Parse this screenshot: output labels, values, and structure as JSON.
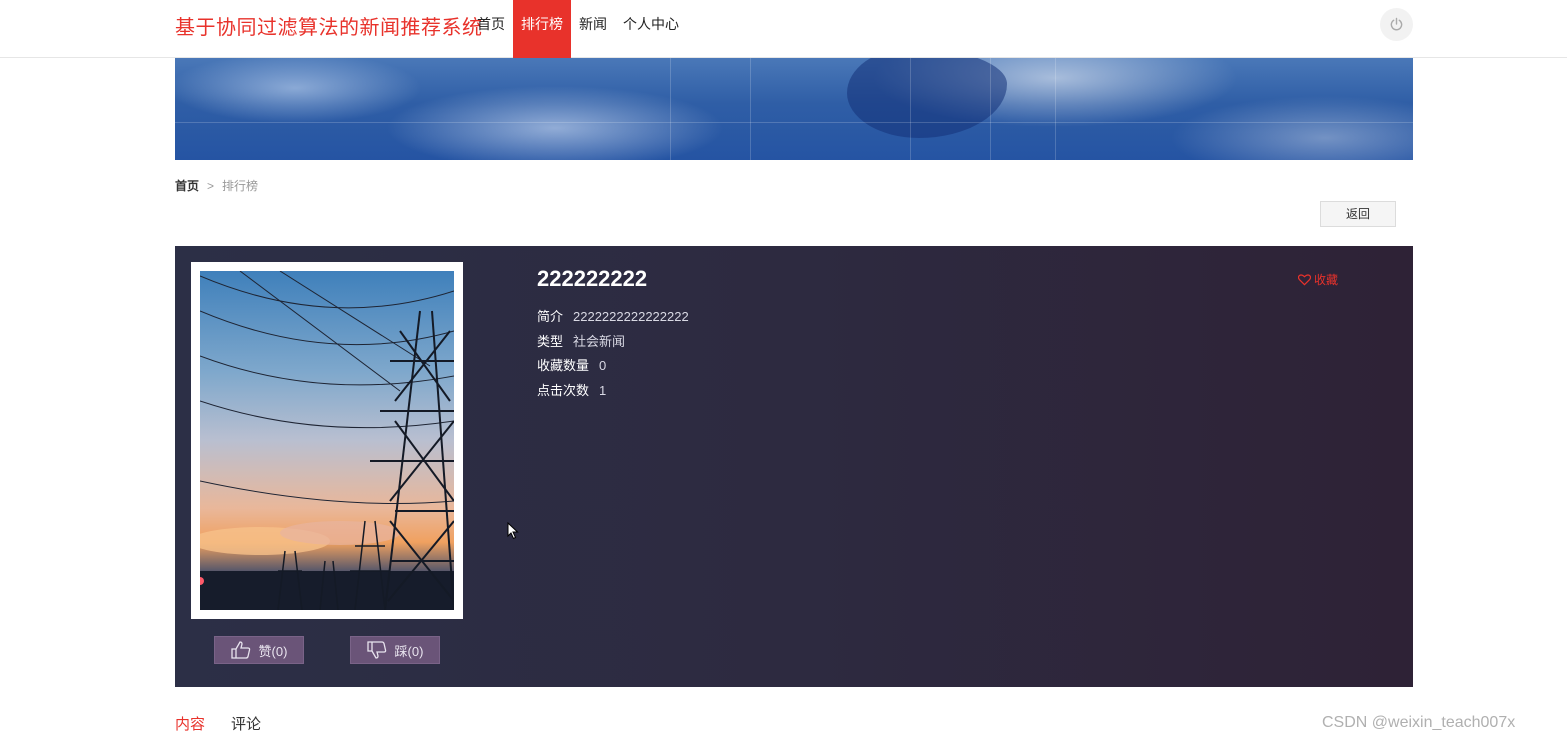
{
  "header": {
    "site_title": "基于协同过滤算法的新闻推荐系统",
    "nav": [
      {
        "label": "首页",
        "active": false
      },
      {
        "label": "排行榜",
        "active": true
      },
      {
        "label": "新闻",
        "active": false
      },
      {
        "label": "个人中心",
        "active": false
      }
    ],
    "power_icon": "power-icon"
  },
  "breadcrumb": {
    "home": "首页",
    "separator": ">",
    "current": "排行榜"
  },
  "actions": {
    "back_label": "返回"
  },
  "detail": {
    "title": "222222222",
    "favorite_label": "收藏",
    "fields": [
      {
        "key": "简介",
        "value": "2222222222222222"
      },
      {
        "key": "类型",
        "value": "社会新闻"
      },
      {
        "key": "收藏数量",
        "value": "0"
      },
      {
        "key": "点击次数",
        "value": "1"
      }
    ],
    "like_label": "赞(0)",
    "dislike_label": "踩(0)"
  },
  "tabs": [
    {
      "label": "内容",
      "active": true
    },
    {
      "label": "评论",
      "active": false
    }
  ],
  "watermark": "CSDN @weixin_teach007x",
  "colors": {
    "brand_red": "#e8322b",
    "panel_bg": "#2d2a40",
    "vote_btn": "#6a5478"
  }
}
